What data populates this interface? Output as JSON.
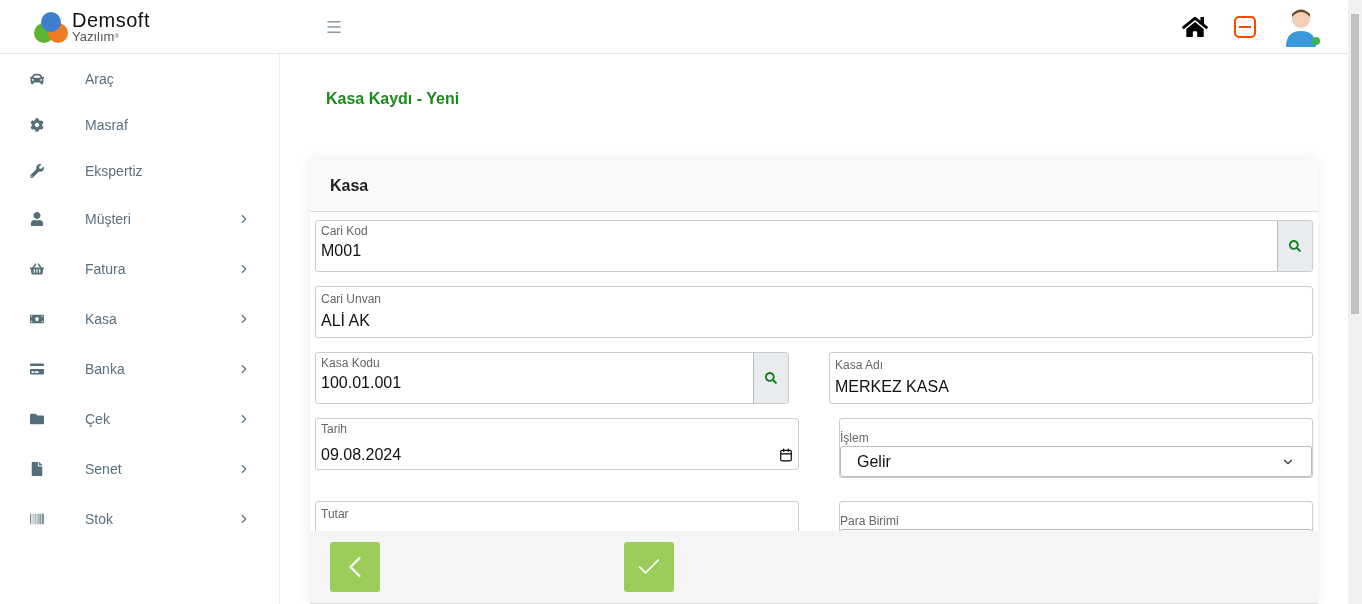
{
  "header": {
    "logo": {
      "name": "Demsoft",
      "tagline": "Yazılım",
      "mark": "®"
    },
    "user": {
      "online": true
    }
  },
  "sidebar": {
    "items": [
      {
        "label": "Araç",
        "submenu": false
      },
      {
        "label": "Masraf",
        "submenu": false
      },
      {
        "label": "Ekspertiz",
        "submenu": false
      },
      {
        "label": "Müşteri",
        "submenu": true
      },
      {
        "label": "Fatura",
        "submenu": true
      },
      {
        "label": "Kasa",
        "submenu": true
      },
      {
        "label": "Banka",
        "submenu": true
      },
      {
        "label": "Çek",
        "submenu": true
      },
      {
        "label": "Senet",
        "submenu": true
      },
      {
        "label": "Stok",
        "submenu": true
      }
    ]
  },
  "page_title": "Kasa Kaydı - Yeni",
  "card": {
    "title": "Kasa",
    "rows": [
      [
        {
          "kind": "lookup",
          "label": "Cari Kod",
          "value": "M001"
        }
      ],
      [
        {
          "kind": "text",
          "label": "Cari Unvan",
          "value": "ALİ AK"
        }
      ],
      [
        {
          "kind": "lookup",
          "label": "Kasa Kodu",
          "value": "100.01.001"
        },
        {
          "kind": "text",
          "label": "Kasa Adı",
          "value": "MERKEZ KASA"
        }
      ],
      [
        {
          "kind": "date",
          "label": "Tarih",
          "value": "09.08.2024"
        },
        {
          "kind": "select",
          "label": "İşlem",
          "value": "Gelir"
        }
      ],
      [
        {
          "kind": "text",
          "label": "Tutar"
        },
        {
          "kind": "select",
          "label": "Para Birimi"
        }
      ]
    ],
    "footer_buttons": [
      {
        "kind": "back"
      },
      {
        "kind": "save"
      }
    ]
  }
}
